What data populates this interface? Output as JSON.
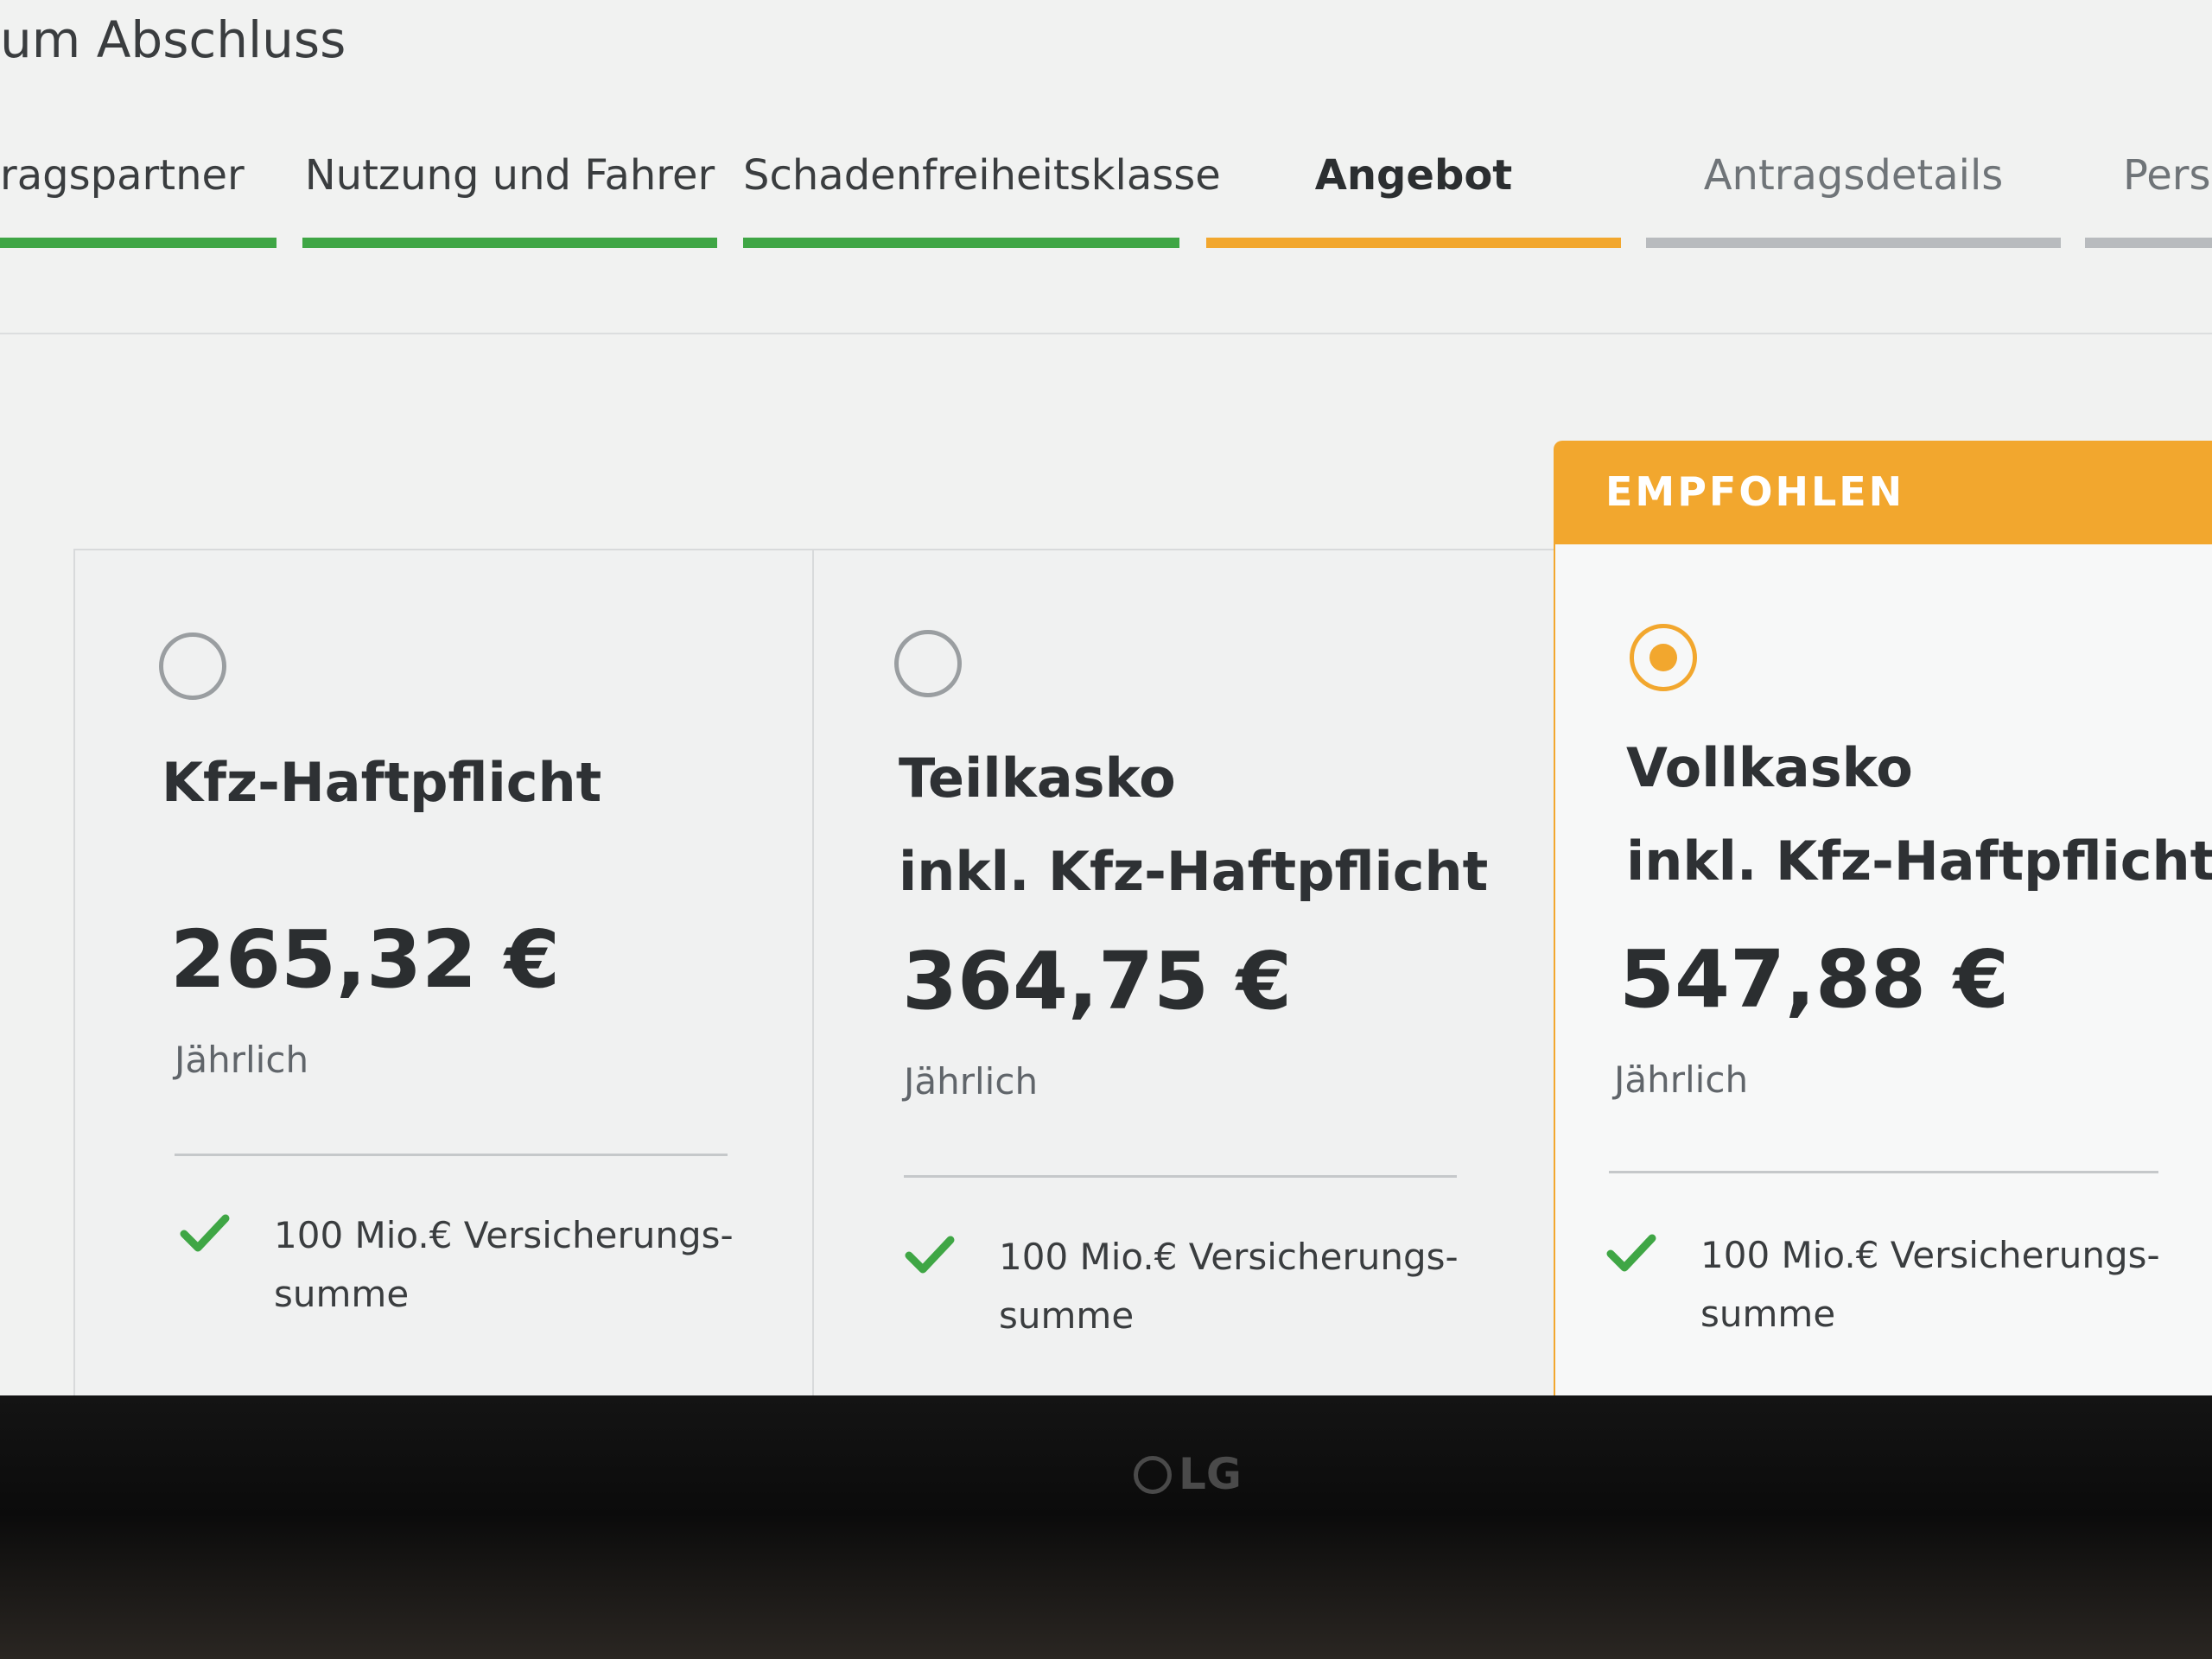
{
  "page": {
    "title": "um Abschluss"
  },
  "stepper": {
    "steps": [
      {
        "label": "ragspartner",
        "status": "done"
      },
      {
        "label": "Nutzung und Fahrer",
        "status": "done"
      },
      {
        "label": "Schadenfreiheitsklasse",
        "status": "done"
      },
      {
        "label": "Angebot",
        "status": "current"
      },
      {
        "label": "Antragsdetails",
        "status": "upcoming"
      },
      {
        "label": "Pers",
        "status": "upcoming"
      }
    ]
  },
  "colors": {
    "done": "#3fa645",
    "current": "#f2a72e",
    "upcoming": "#b8bbbe"
  },
  "plans": [
    {
      "name_line1": "Kfz-Haftpflicht",
      "name_line2": "",
      "price": "265,32 €",
      "period": "Jährlich",
      "feature_line1": "100 Mio.€ Versicherungs-",
      "feature_line2": "summe",
      "selected": false
    },
    {
      "name_line1": "Teilkasko",
      "name_line2": "inkl. Kfz-Haftpflicht",
      "price": "364,75 €",
      "period": "Jährlich",
      "feature_line1": "100 Mio.€ Versicherungs-",
      "feature_line2": "summe",
      "selected": false
    },
    {
      "name_line1": "Vollkasko",
      "name_line2": "inkl. Kfz-Haftpflicht",
      "price": "547,88 €",
      "period": "Jährlich",
      "feature_line1": "100 Mio.€ Versicherungs-",
      "feature_line2": "summe",
      "selected": true
    }
  ],
  "badge": {
    "label": "EMPFOHLEN"
  },
  "icons": {
    "radio": "radio-button-icon",
    "feature": "checkmark-icon"
  },
  "monitor": {
    "brand": "LG"
  }
}
